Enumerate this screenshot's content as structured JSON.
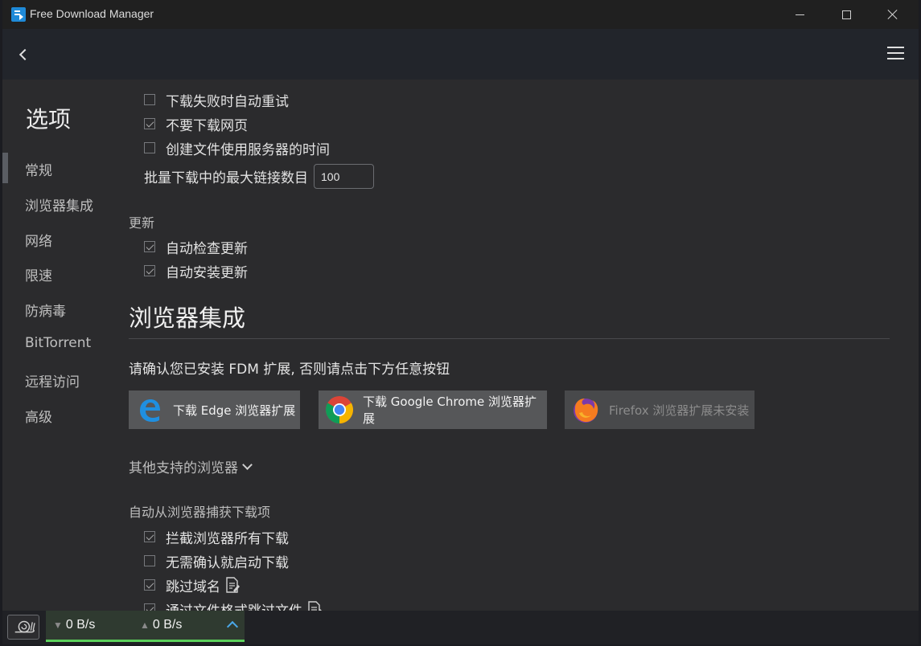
{
  "window": {
    "title": "Free Download Manager"
  },
  "sidebar": {
    "title": "选项",
    "items": [
      {
        "label": "常规"
      },
      {
        "label": "浏览器集成"
      },
      {
        "label": "网络"
      },
      {
        "label": "限速"
      },
      {
        "label": "防病毒"
      },
      {
        "label": "BitTorrent"
      },
      {
        "label": "远程访问"
      },
      {
        "label": "高级"
      }
    ]
  },
  "general": {
    "cut_off_label": "下载失败时自动重试",
    "dont_download_pages_label": "不要下载网页",
    "server_time_label": "创建文件使用服务器的时间",
    "max_links_label": "批量下载中的最大链接数目",
    "max_links_value": "100"
  },
  "updates": {
    "section_label": "更新",
    "auto_check_label": "自动检查更新",
    "auto_install_label": "自动安装更新"
  },
  "browser": {
    "heading": "浏览器集成",
    "confirm_text": "请确认您已安装 FDM 扩展, 否则请点击下方任意按钮",
    "edge_button": "下载 Edge 浏览器扩展",
    "chrome_button": "下载 Google Chrome 浏览器扩展",
    "firefox_button": "Firefox 浏览器扩展未安装",
    "other_browsers": "其他支持的浏览器",
    "capture_section": "自动从浏览器捕获下载项",
    "intercept_all_label": "拦截浏览器所有下载",
    "no_confirm_label": "无需确认就启动下载",
    "skip_domains_label": "跳过域名",
    "skip_filetypes_label": "通过文件格式跳过文件"
  },
  "status": {
    "down_speed": "0 B/s",
    "up_speed": "0 B/s"
  }
}
